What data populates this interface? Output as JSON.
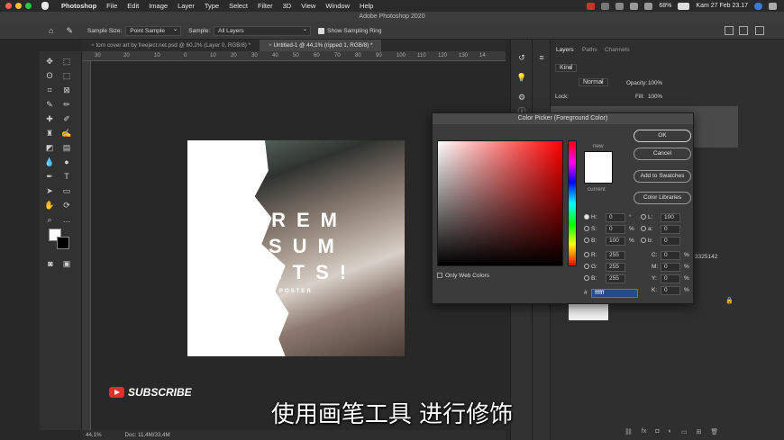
{
  "menubar": {
    "app": "Photoshop",
    "menus": [
      "File",
      "Edit",
      "Image",
      "Layer",
      "Type",
      "Select",
      "Filter",
      "3D",
      "View",
      "Window",
      "Help"
    ],
    "battery": "68%",
    "datetime": "Kam 27 Feb  23.17"
  },
  "window_title": "Adobe Photoshop 2020",
  "options": {
    "sample_size_label": "Sample Size:",
    "sample_size_value": "Point Sample",
    "sample_label": "Sample:",
    "sample_value": "All Layers",
    "show_ring": "Show Sampling Ring"
  },
  "tabs": [
    {
      "label": "torn cover art by freeject.net.psd @ 60,2% (Layer 0, RGB/8) *"
    },
    {
      "label": "Untitled-1 @ 44,1% (ripped 1, RGB/8) *"
    }
  ],
  "ruler_ticks": [
    "30",
    "20",
    "10",
    "0",
    "10",
    "20",
    "30",
    "40",
    "50",
    "60",
    "70",
    "80",
    "90",
    "100",
    "110",
    "120",
    "130",
    "14"
  ],
  "poster": {
    "line1": "OREM",
    "line2": "SUM",
    "line3": "XTS!",
    "tag": "POSTER"
  },
  "status": {
    "zoom": "44,1%",
    "doc": "Doc: 11,4M/33,4M"
  },
  "panel": {
    "tabs": [
      "Layers",
      "Paths",
      "Channels"
    ],
    "kind": "Kind",
    "blend": "Normal",
    "opacity_label": "Opacity:",
    "opacity": "100%",
    "lock_label": "Lock:",
    "fill_label": "Fill:",
    "fill": "100%",
    "layer_number": "3325142"
  },
  "picker": {
    "title": "Color Picker (Foreground Color)",
    "new_label": "new",
    "current_label": "current",
    "ok": "OK",
    "cancel": "Cancel",
    "add_swatches": "Add to Swatches",
    "color_libraries": "Color Libraries",
    "only_web": "Only Web Colors",
    "hex": "ffffff",
    "fields": {
      "H": "0",
      "H_unit": "°",
      "S": "0",
      "S_unit": "%",
      "B": "100",
      "B_unit": "%",
      "R": "255",
      "G": "255",
      "Bl": "255",
      "L": "100",
      "a": "0",
      "b": "0",
      "C": "0",
      "M": "0",
      "Y": "0",
      "K": "0",
      "pct": "%"
    }
  },
  "subscribe": "SUBSCRIBE",
  "subtitle": "使用画笔工具 进行修饰",
  "colors": {
    "accent": "#e52d27",
    "panel": "#2f2f2f",
    "selection_blue": "#3a7bd5"
  }
}
